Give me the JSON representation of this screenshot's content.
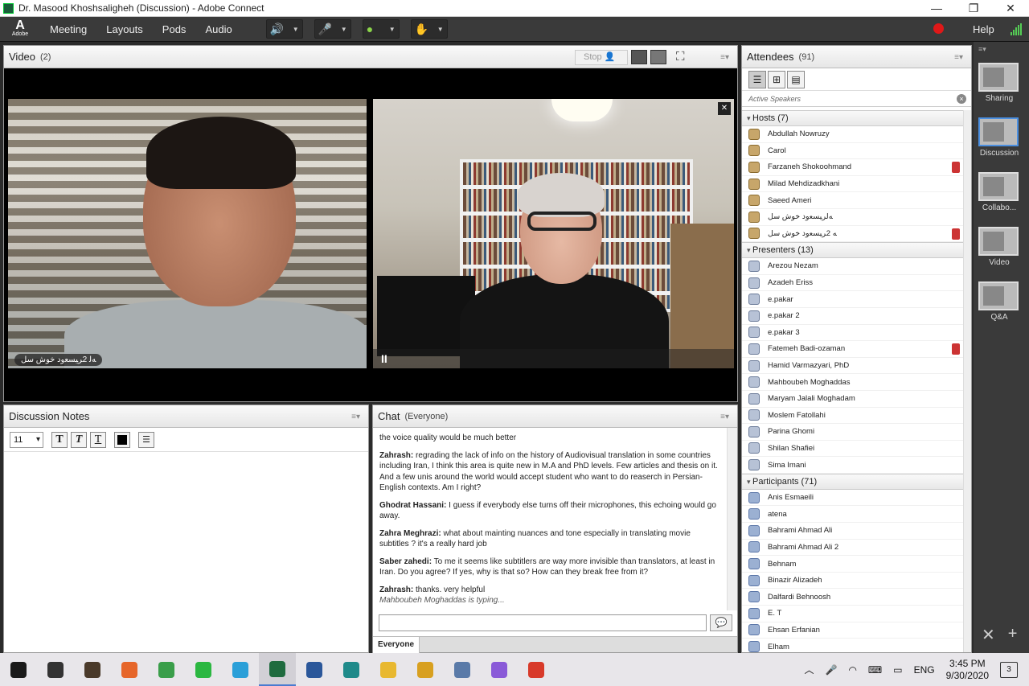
{
  "window": {
    "title": "Dr. Masood Khoshsaligheh (Discussion) - Adobe Connect",
    "controls": [
      "—",
      "❐",
      "✕"
    ]
  },
  "menubar": {
    "logo_text": "Adobe",
    "items": [
      "Meeting",
      "Layouts",
      "Pods",
      "Audio"
    ],
    "help": "Help",
    "tools": [
      {
        "name": "speaker",
        "icon": "speaker-icon"
      },
      {
        "name": "microphone",
        "icon": "microphone-icon"
      },
      {
        "name": "webcam",
        "icon": "webcam-icon"
      },
      {
        "name": "raise-hand",
        "icon": "hand-icon"
      }
    ],
    "record_color": "#e01818"
  },
  "video_pod": {
    "title": "Video",
    "count": "(2)",
    "stop_label": "Stop",
    "feed1_label": "ﻪﻟ 2ﺮﻴﺴﻌﻭﺩ ﺧﻮﺵ ﺳﻞ",
    "close_label": "✕",
    "pause_label": "II"
  },
  "notes_pod": {
    "title": "Discussion Notes",
    "font_size": "11"
  },
  "chat_pod": {
    "title": "Chat",
    "scope": "(Everyone)",
    "tab_label": "Everyone",
    "typing": "Mahboubeh Moghaddas is typing...",
    "messages": [
      {
        "sender": "",
        "text": "the voice quality would be much better"
      },
      {
        "sender": "Zahrash:",
        "text": " regrading the lack of info on the history of Audiovisual translation in some countries including Iran, I think this area is quite new in M.A and PhD levels. Few articles and thesis on it.  And a few unis around the world would accept  student who want to do reaserch in Persian-English contexts. Am I right?"
      },
      {
        "sender": "Ghodrat Hassani:",
        "text": " I guess if everybody else turns off their microphones, this echoing would go away."
      },
      {
        "sender": "Zahra Meghrazi:",
        "text": " what about mainting nuances and tone especially in translating movie subtitles ? it's a really hard job"
      },
      {
        "sender": "Saber zahedi:",
        "text": " To me it seems like subtitlers are way more invisible than translators, at least in Iran. Do you agree? If yes, why is that so? How can they break free from it?"
      },
      {
        "sender": "Zahrash:",
        "text": " thanks. very helpful"
      }
    ]
  },
  "attendees_pod": {
    "title": "Attendees",
    "count": "(91)",
    "active_speakers": "Active Speakers",
    "groups": [
      {
        "label": "Hosts (7)",
        "role": "host",
        "people": [
          {
            "name": "Abdullah Nowruzy",
            "mic": false
          },
          {
            "name": "Carol",
            "mic": false
          },
          {
            "name": "Farzaneh Shokoohmand",
            "mic": true
          },
          {
            "name": "Milad Mehdizadkhani",
            "mic": false
          },
          {
            "name": "Saeed Ameri",
            "mic": false
          },
          {
            "name": "ﻪﻟﺮﻴﺴﻌﻭﺩ ﺧﻮﺵ ﺳﻞ",
            "mic": false
          },
          {
            "name": "ﻪ 2ﺮﻴﺴﻌﻭﺩ ﺧﻮﺵ ﺳﻞ",
            "mic": true
          }
        ]
      },
      {
        "label": "Presenters (13)",
        "role": "pres",
        "people": [
          {
            "name": "Arezou Nezam",
            "mic": false
          },
          {
            "name": "Azadeh Eriss",
            "mic": false
          },
          {
            "name": "e.pakar",
            "mic": false
          },
          {
            "name": "e.pakar 2",
            "mic": false
          },
          {
            "name": "e.pakar 3",
            "mic": false
          },
          {
            "name": "Fatemeh Badi-ozaman",
            "mic": true
          },
          {
            "name": "Hamid Varmazyari, PhD",
            "mic": false
          },
          {
            "name": "Mahboubeh Moghaddas",
            "mic": false
          },
          {
            "name": "Maryam Jalali Moghadam",
            "mic": false
          },
          {
            "name": "Moslem Fatollahi",
            "mic": false
          },
          {
            "name": "Parina Ghomi",
            "mic": false
          },
          {
            "name": "Shilan Shafiei",
            "mic": false
          },
          {
            "name": "Sima Imani",
            "mic": false
          }
        ]
      },
      {
        "label": "Participants (71)",
        "role": "part",
        "people": [
          {
            "name": "Anis Esmaeili",
            "mic": false
          },
          {
            "name": "atena",
            "mic": false
          },
          {
            "name": "Bahrami Ahmad Ali",
            "mic": false
          },
          {
            "name": "Bahrami Ahmad Ali 2",
            "mic": false
          },
          {
            "name": "Behnam",
            "mic": false
          },
          {
            "name": "Binazir Alizadeh",
            "mic": false
          },
          {
            "name": "Dalfardi Behnoosh",
            "mic": false
          },
          {
            "name": "E. T",
            "mic": false
          },
          {
            "name": "Ehsan Erfanian",
            "mic": false
          },
          {
            "name": "Elham",
            "mic": false
          }
        ]
      }
    ]
  },
  "layouts": [
    {
      "label": "Sharing",
      "selected": false
    },
    {
      "label": "Discussion",
      "selected": true
    },
    {
      "label": "Collabo...",
      "selected": false
    },
    {
      "label": "Video",
      "selected": false
    },
    {
      "label": "Q&A",
      "selected": false
    }
  ],
  "taskbar": {
    "apps": [
      {
        "name": "windows-start-icon",
        "color": "#1a1a1a"
      },
      {
        "name": "task-view-icon",
        "color": "#333333"
      },
      {
        "name": "store-icon",
        "color": "#4a3a2a"
      },
      {
        "name": "firefox-icon",
        "color": "#e6662a"
      },
      {
        "name": "chrome-icon",
        "color": "#3a9e4a"
      },
      {
        "name": "whatsapp-icon",
        "color": "#2bb741"
      },
      {
        "name": "telegram-icon",
        "color": "#2a9fd8"
      },
      {
        "name": "adobe-connect-icon",
        "color": "#1f6b3f"
      },
      {
        "name": "word-icon",
        "color": "#2b579a"
      },
      {
        "name": "app-icon",
        "color": "#1f8a8a"
      },
      {
        "name": "file-explorer-icon",
        "color": "#e8b830"
      },
      {
        "name": "app2-icon",
        "color": "#d8a020"
      },
      {
        "name": "app3-icon",
        "color": "#5a7aa8"
      },
      {
        "name": "app4-icon",
        "color": "#8a5ad8"
      },
      {
        "name": "recorder-icon",
        "color": "#d83a2a"
      }
    ],
    "lang": "ENG",
    "time": "3:45 PM",
    "date": "9/30/2020",
    "notifications": "3"
  }
}
